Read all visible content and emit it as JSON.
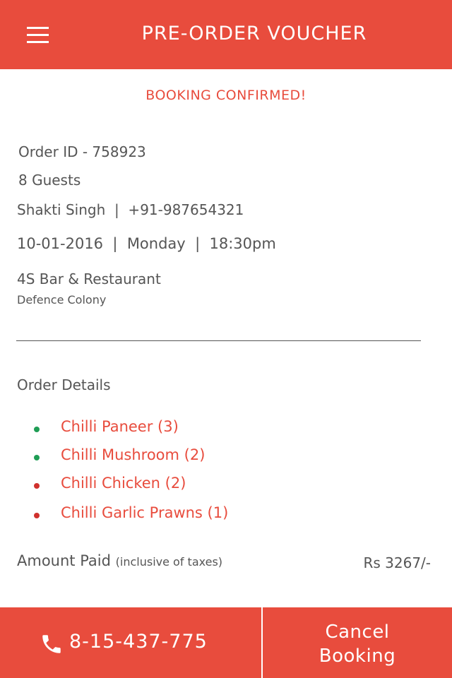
{
  "header": {
    "title": "PRE-ORDER VOUCHER",
    "menu_icon": "hamburger-menu-icon"
  },
  "status": "BOOKING CONFIRMED!",
  "booking": {
    "order_id": "Order ID - 758923",
    "guests": "8 Guests",
    "contact": "Shakti Singh  |  +91-987654321",
    "datetime": "10-01-2016  |  Monday  |  18:30pm",
    "restaurant": "4S Bar & Restaurant",
    "locality": "Defence Colony"
  },
  "order": {
    "heading": "Order Details",
    "items": [
      {
        "label": "Chilli Paneer (3)",
        "type": "veg"
      },
      {
        "label": "Chilli Mushroom (2)",
        "type": "veg"
      },
      {
        "label": "Chilli Chicken (2)",
        "type": "non-veg"
      },
      {
        "label": "Chilli Garlic Prawns (1)",
        "type": "non-veg"
      }
    ]
  },
  "amount": {
    "label": "Amount Paid",
    "note": "(inclusive of taxes)",
    "value": "Rs 3267/-"
  },
  "footer": {
    "phone": "8-15-437-775",
    "phone_icon": "phone-icon",
    "cancel_label": "Cancel\nBooking"
  },
  "colors": {
    "accent": "#e84c3d",
    "text": "#555555",
    "veg": "#1f9d55",
    "non_veg": "#d0312d"
  }
}
